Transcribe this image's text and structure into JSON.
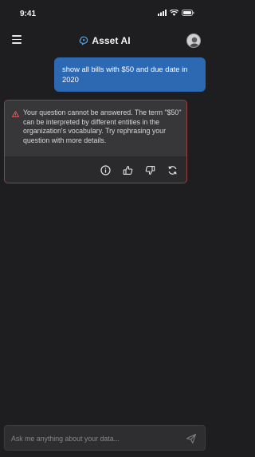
{
  "status_bar": {
    "time": "9:41"
  },
  "header": {
    "title": "Asset AI",
    "menu_icon": "hamburger-menu-icon",
    "logo_icon": "brain-logo-icon",
    "avatar_icon": "user-avatar"
  },
  "conversation": {
    "user_message": "show all bills with $50 and due date in 2020",
    "error": {
      "icon": "warning-triangle-icon",
      "text": "Your question cannot be answered. The term \"$50\" can be interpreted by different entities in the organization's vocabulary. Try rephrasing your question with more details.",
      "actions": [
        "info-icon",
        "thumbs-up-icon",
        "thumbs-down-icon",
        "refresh-icon"
      ]
    }
  },
  "composer": {
    "placeholder": "Ask me anything about your data...",
    "send_icon": "send-icon"
  },
  "colors": {
    "background": "#1e1e20",
    "user_bubble": "#2d68b2",
    "error_border": "#9a3f42",
    "warning": "#e0585b"
  }
}
